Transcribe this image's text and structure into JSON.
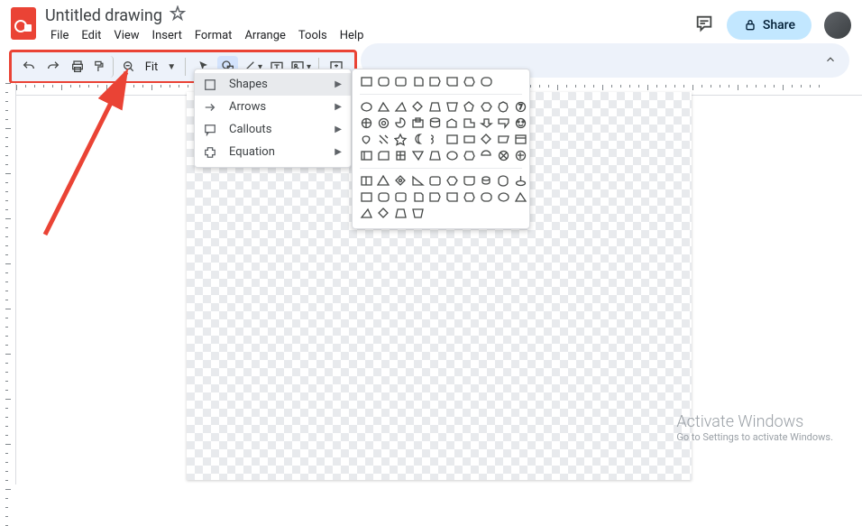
{
  "title": "Untitled drawing",
  "menus": [
    "File",
    "Edit",
    "View",
    "Insert",
    "Format",
    "Arrange",
    "Tools",
    "Help"
  ],
  "share": "Share",
  "zoom": "Fit",
  "popup": {
    "shapes": "Shapes",
    "arrows": "Arrows",
    "callouts": "Callouts",
    "equation": "Equation"
  },
  "watermark": {
    "l1": "Activate Windows",
    "l2": "Go to Settings to activate Windows."
  }
}
